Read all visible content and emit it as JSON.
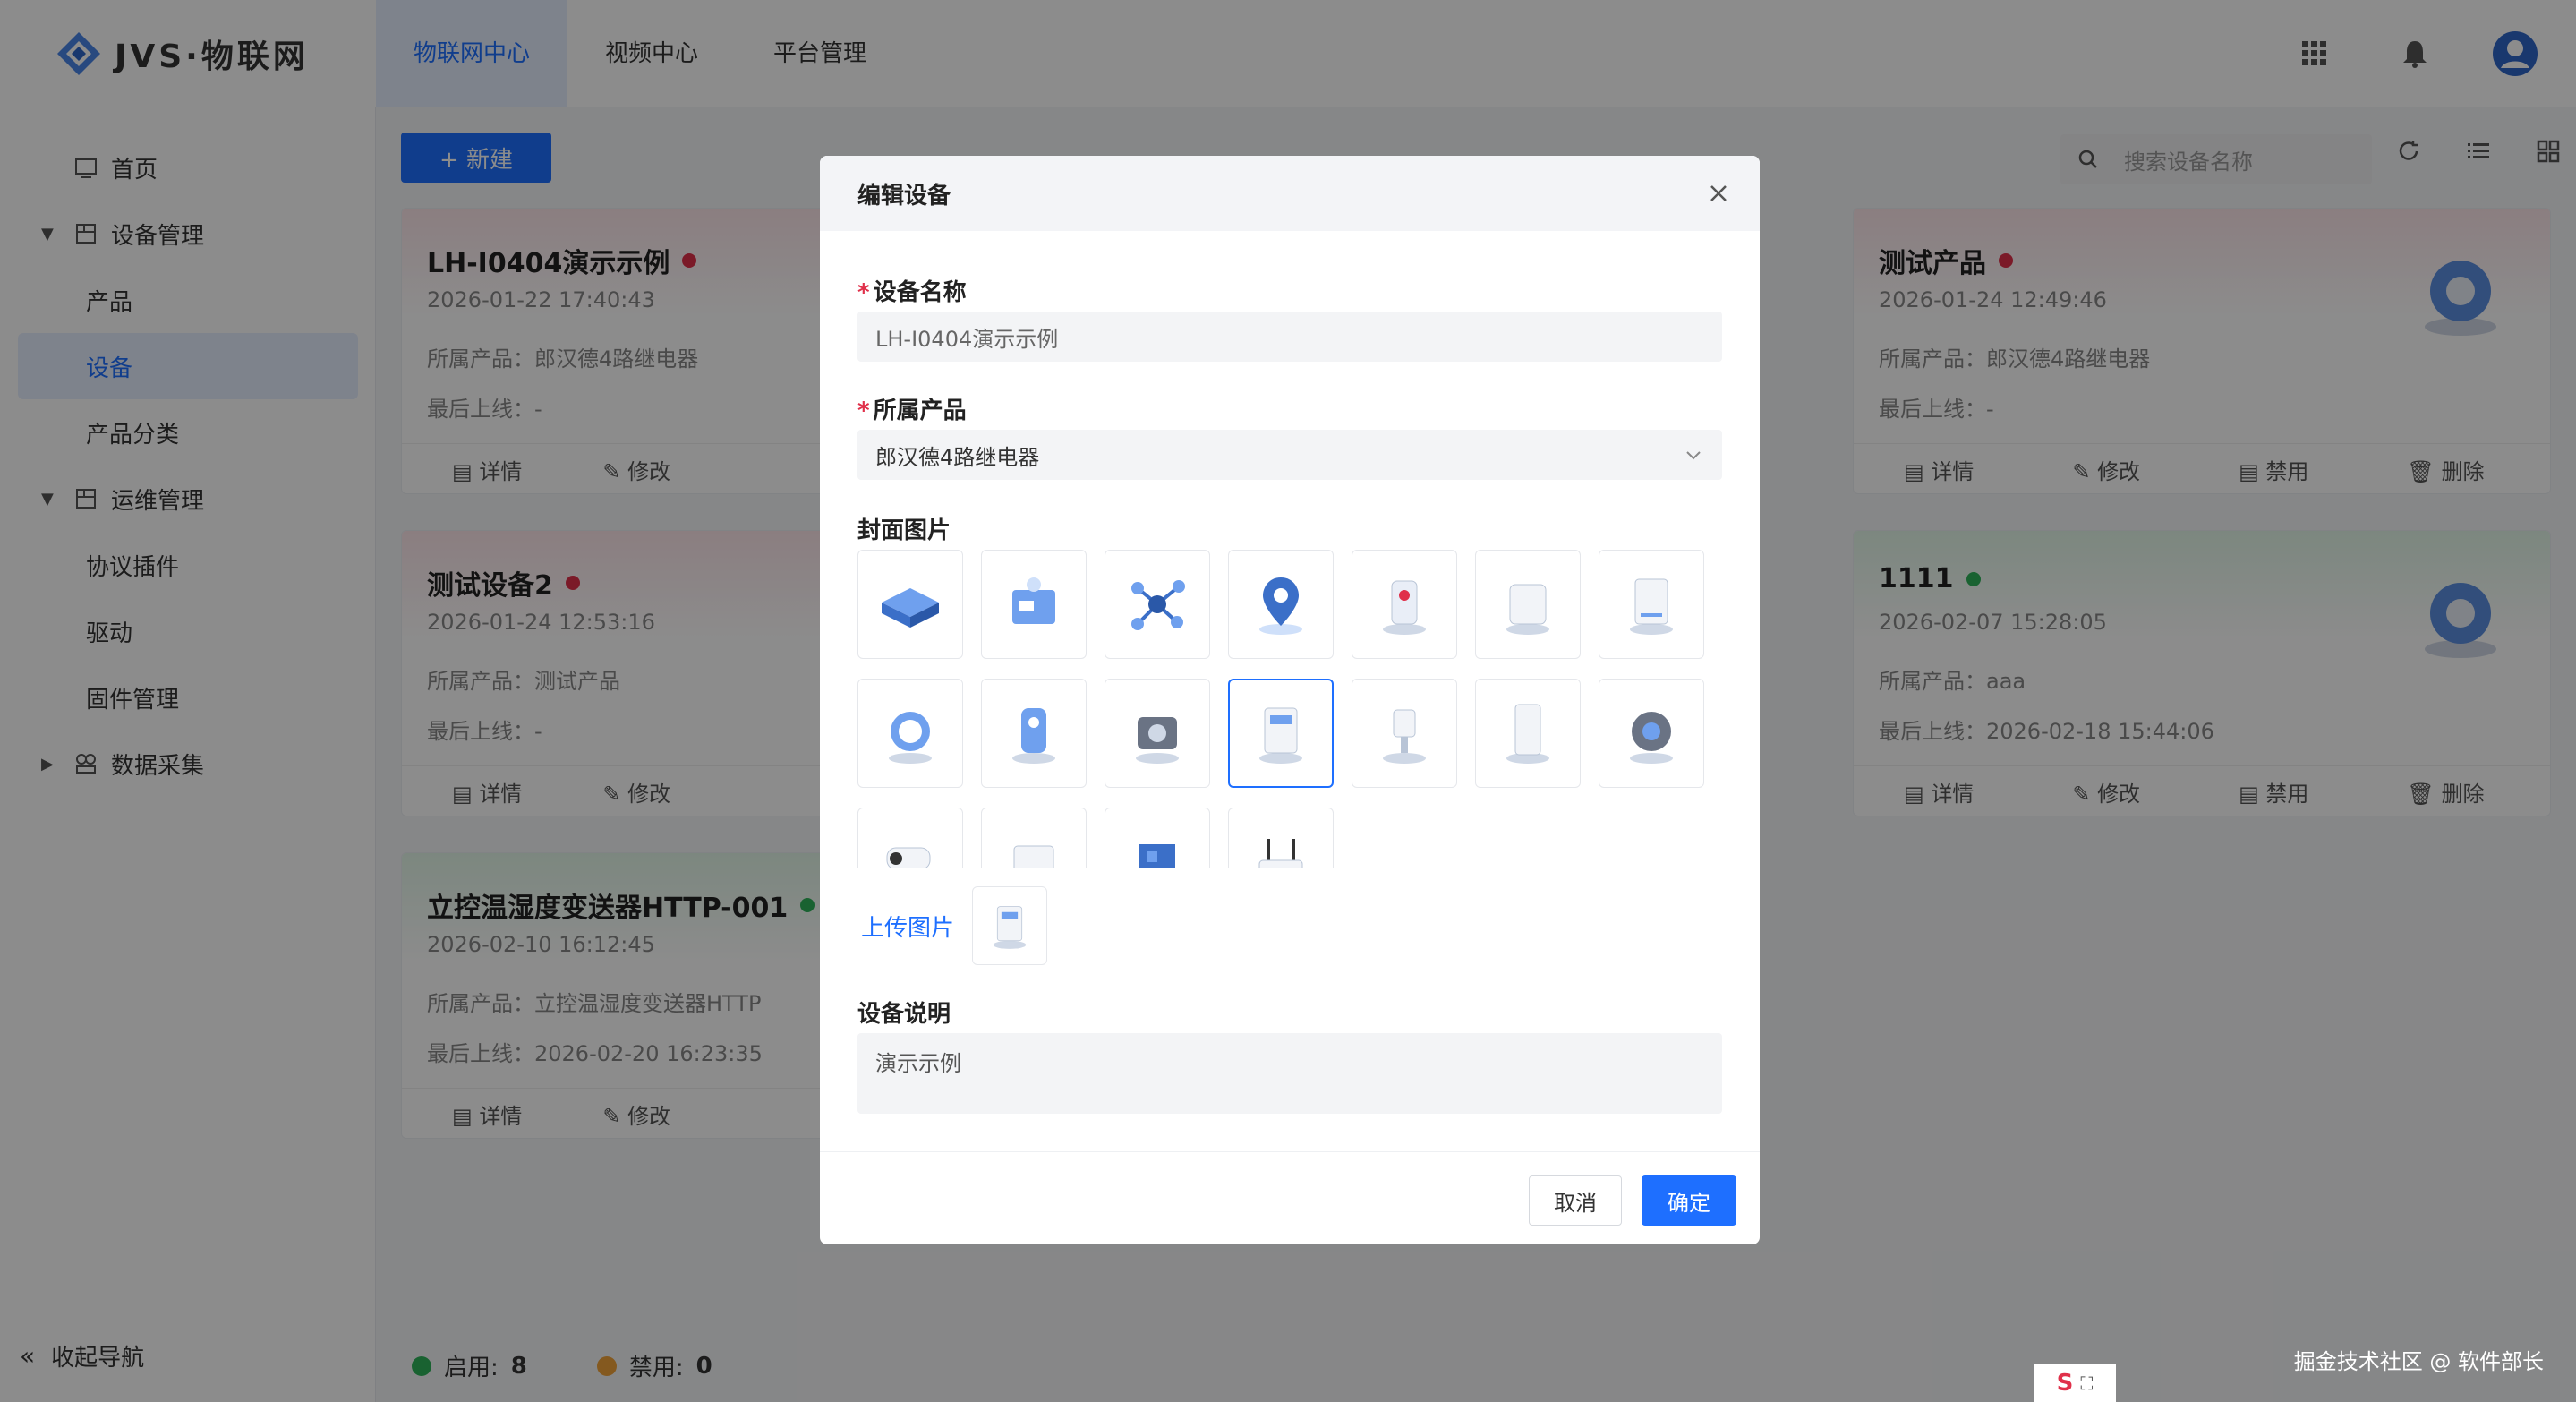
{
  "app": {
    "logo_text": "JVS·物联网"
  },
  "topnav": {
    "tabs": [
      {
        "label": "物联网中心",
        "active": true
      },
      {
        "label": "视频中心",
        "active": false
      },
      {
        "label": "平台管理",
        "active": false
      }
    ]
  },
  "header_icons": [
    "apps-grid-icon",
    "bell-icon",
    "user-avatar-icon"
  ],
  "sidebar": {
    "items": [
      {
        "label": "首页",
        "level": 1,
        "icon": "home-icon"
      },
      {
        "label": "设备管理",
        "level": 1,
        "icon": "device-manage-icon",
        "expanded": true
      },
      {
        "label": "产品",
        "level": 2
      },
      {
        "label": "设备",
        "level": 2,
        "active": true
      },
      {
        "label": "产品分类",
        "level": 2
      },
      {
        "label": "运维管理",
        "level": 1,
        "icon": "ops-icon",
        "expanded": true
      },
      {
        "label": "协议插件",
        "level": 2
      },
      {
        "label": "驱动",
        "level": 2
      },
      {
        "label": "固件管理",
        "level": 2
      },
      {
        "label": "数据采集",
        "level": 1,
        "icon": "data-collect-icon",
        "expanded": false
      }
    ],
    "collapse_label": "收起导航"
  },
  "toolbar": {
    "new_label": "+ 新建",
    "search_placeholder": "搜索设备名称"
  },
  "cards": [
    {
      "name": "LH-I0404演示示例",
      "status": "red",
      "time": "2026-01-22 17:40:43",
      "product": "所属产品：郎汉德4路继电器",
      "last_online": "最后上线：-",
      "actions": [
        "详情",
        "修改"
      ]
    },
    {
      "name": "测试设备2",
      "status": "red",
      "time": "2026-01-24 12:53:16",
      "product": "所属产品：测试产品",
      "last_online": "最后上线：-",
      "actions": [
        "详情",
        "修改"
      ]
    },
    {
      "name": "立控温湿度变送器HTTP-001",
      "status": "green",
      "time": "2026-02-10 16:12:45",
      "product": "所属产品：立控温湿度变送器HTTP",
      "last_online": "最后上线：2026-02-20 16:23:35",
      "actions": [
        "详情",
        "修改"
      ]
    },
    {
      "name": "测试产品",
      "status": "red",
      "time": "2026-01-24 12:49:46",
      "product": "所属产品：郎汉德4路继电器",
      "last_online": "最后上线：-",
      "actions": [
        "详情",
        "修改",
        "禁用",
        "删除"
      ]
    },
    {
      "name": "1111",
      "status": "green",
      "time": "2026-02-07 15:28:05",
      "product": "所属产品：aaa",
      "last_online": "最后上线：2026-02-18 15:44:06",
      "actions": [
        "详情",
        "修改",
        "禁用",
        "删除"
      ]
    }
  ],
  "footer": {
    "enabled_label": "启用:",
    "enabled_count": "8",
    "disabled_label": "禁用:",
    "disabled_count": "0"
  },
  "modal": {
    "title": "编辑设备",
    "device_name_label": "设备名称",
    "device_name_value": "LH-I0404演示示例",
    "product_label": "所属产品",
    "product_value": "郎汉德4路继电器",
    "cover_label": "封面图片",
    "upload_label": "上传图片",
    "desc_label": "设备说明",
    "desc_value": "演示示例",
    "cancel_label": "取消",
    "ok_label": "确定",
    "selected_tile": 10
  },
  "credit": "掘金技术社区 @ 软件部长",
  "colors": {
    "primary": "#1e6fff",
    "danger_dot": "#e0304a",
    "success_dot": "#2fb35a",
    "warning_dot": "#f0a23a"
  }
}
